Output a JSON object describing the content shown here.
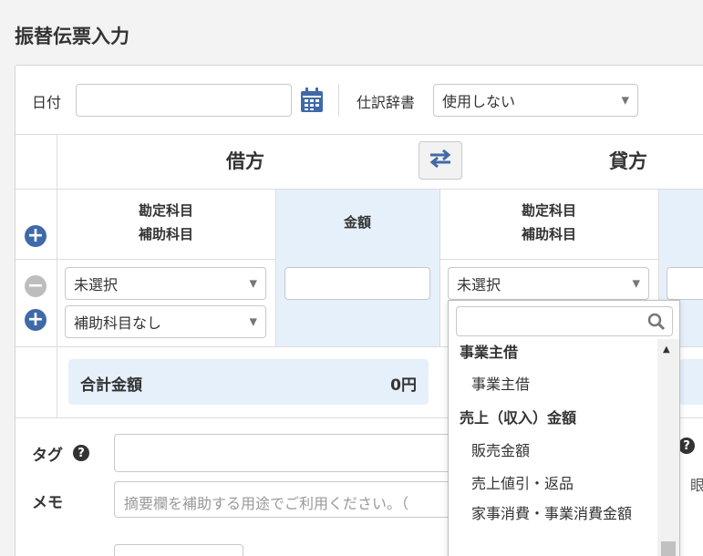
{
  "page": {
    "title": "振替伝票入力"
  },
  "header": {
    "date_label": "日付",
    "date_value": "",
    "dict_label": "仕訳辞書",
    "dict_value": "使用しない"
  },
  "table": {
    "debit_title": "借方",
    "credit_title": "貸方",
    "account_line1": "勘定科目",
    "account_line2": "補助科目",
    "amount_header": "金額"
  },
  "debit_row": {
    "account": "未選択",
    "sub_account": "補助科目なし",
    "amount": ""
  },
  "credit_row": {
    "account": "未選択"
  },
  "totals": {
    "label": "合計金額",
    "value": "0円"
  },
  "meta": {
    "tag_label": "タグ",
    "tag_help": "?",
    "memo_label": "メモ",
    "memo_placeholder": "摘要欄を補助する用途でご利用ください。（",
    "right_help": "?",
    "right_partial": "眼"
  },
  "dropdown": {
    "search_value": "",
    "items": [
      {
        "label": "事業主借",
        "group": true
      },
      {
        "label": "事業主借",
        "group": false
      },
      {
        "label": "売上（収入）金額",
        "group": true
      },
      {
        "label": "販売金額",
        "group": false
      },
      {
        "label": "売上値引・返品",
        "group": false
      },
      {
        "label": "家事消費・事業消費金額",
        "group": false
      }
    ]
  },
  "colors": {
    "accent": "#3f69a8",
    "amount_bg": "#e6f0fb"
  }
}
